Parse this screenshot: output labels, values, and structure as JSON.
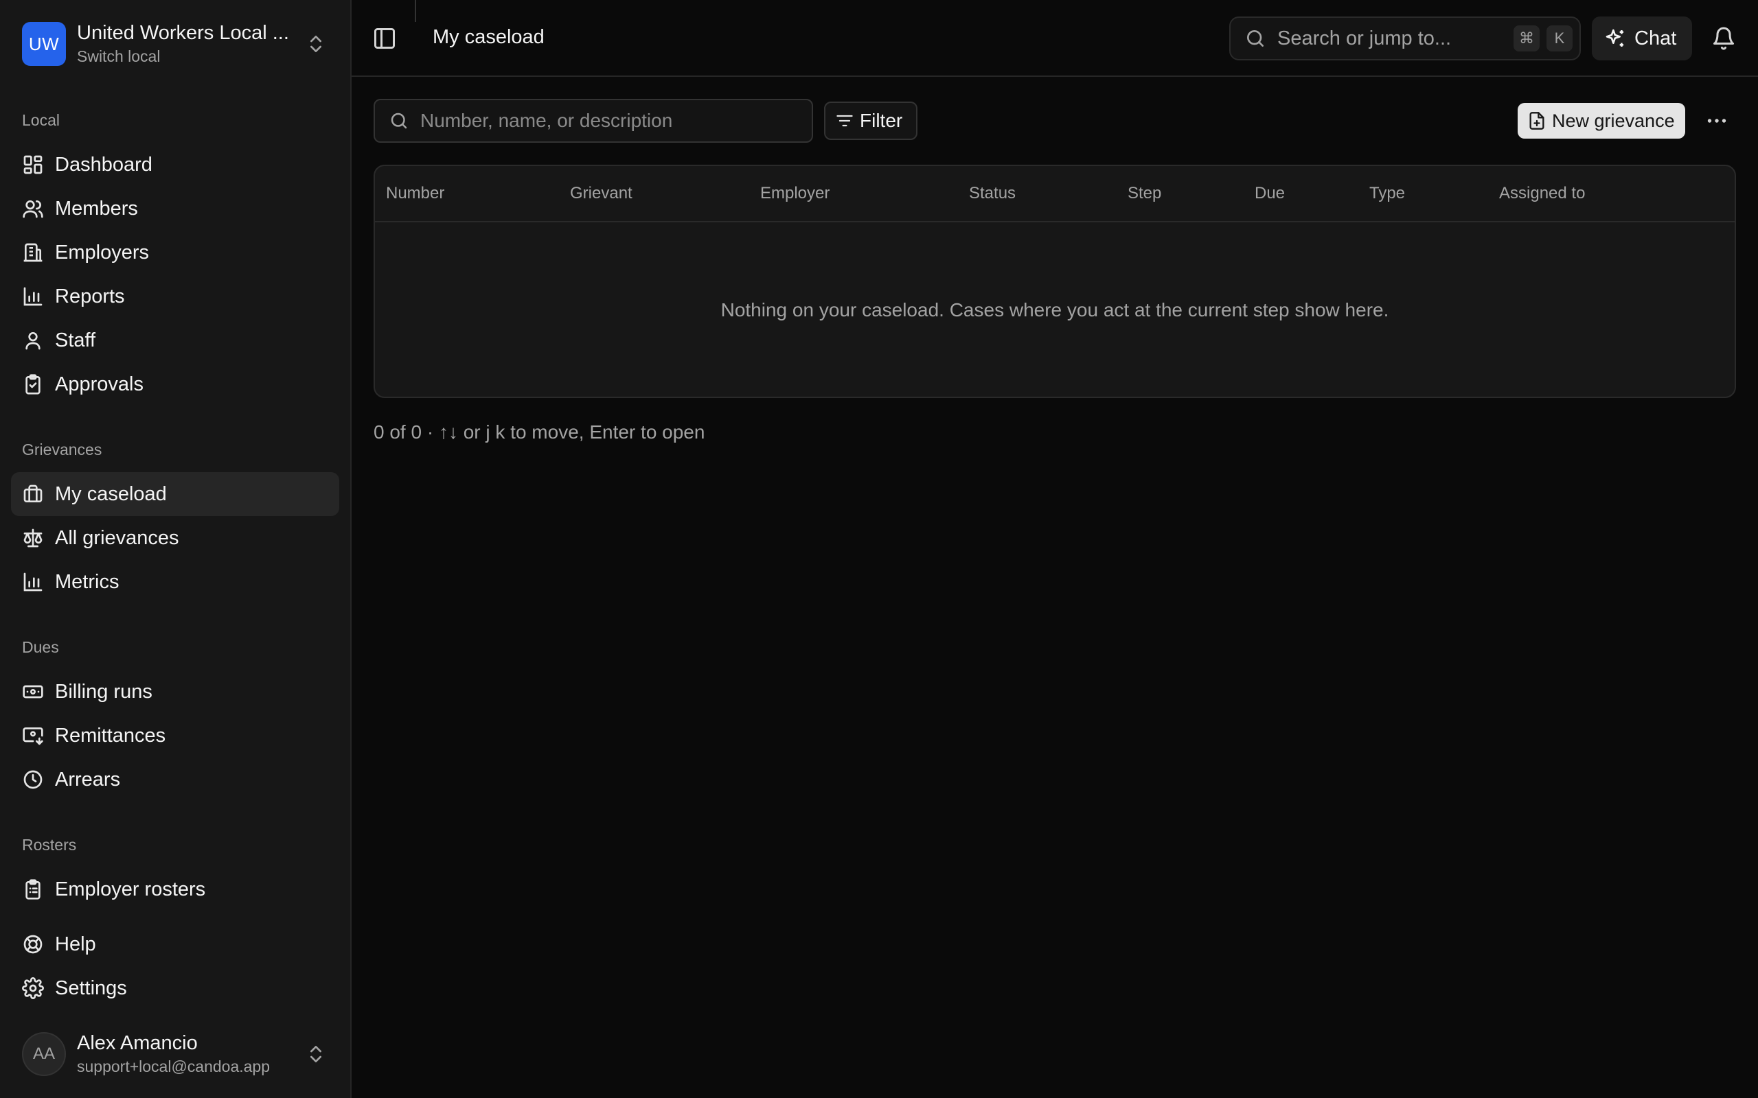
{
  "org": {
    "initials": "UW",
    "name": "United Workers Local ...",
    "subtitle": "Switch local"
  },
  "sections": {
    "local": "Local",
    "grievances": "Grievances",
    "dues": "Dues",
    "rosters": "Rosters"
  },
  "nav": {
    "dashboard": "Dashboard",
    "members": "Members",
    "employers": "Employers",
    "reports": "Reports",
    "staff": "Staff",
    "approvals": "Approvals",
    "my_caseload": "My caseload",
    "all_grievances": "All grievances",
    "metrics": "Metrics",
    "billing_runs": "Billing runs",
    "remittances": "Remittances",
    "arrears": "Arrears",
    "employer_rosters": "Employer rosters",
    "help": "Help",
    "settings": "Settings"
  },
  "user": {
    "initials": "AA",
    "name": "Alex Amancio",
    "email": "support+local@candoa.app"
  },
  "topbar": {
    "title": "My caseload",
    "search_placeholder": "Search or jump to...",
    "shortcut_cmd": "⌘",
    "shortcut_key": "K",
    "chat_label": "Chat"
  },
  "toolbar": {
    "filter_placeholder": "Number, name, or description",
    "filter_label": "Filter",
    "new_label": "New grievance"
  },
  "table": {
    "columns": [
      "Number",
      "Grievant",
      "Employer",
      "Status",
      "Step",
      "Due",
      "Type",
      "Assigned to"
    ],
    "empty_message": "Nothing on your caseload. Cases where you act at the current step show here."
  },
  "footer": "0 of 0 · ↑↓ or j k to move, Enter to open",
  "colors": {
    "accent": "#2563eb",
    "background": "#0a0a0a",
    "sidebar": "#171717"
  }
}
